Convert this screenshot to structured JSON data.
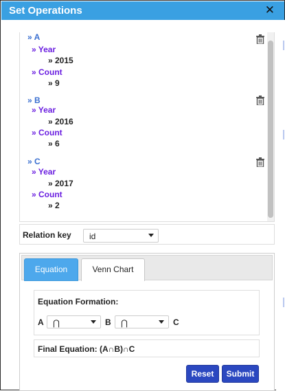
{
  "dialog": {
    "title": "Set Operations",
    "close_icon": "close-icon",
    "close_glyph": "✕"
  },
  "sets": [
    {
      "name": "» A",
      "entries": [
        {
          "key": "» Year",
          "value": "» 2015"
        },
        {
          "key": "» Count",
          "value": "» 9"
        }
      ]
    },
    {
      "name": "» B",
      "entries": [
        {
          "key": "» Year",
          "value": "» 2016"
        },
        {
          "key": "» Count",
          "value": "» 6"
        }
      ]
    },
    {
      "name": "» C",
      "entries": [
        {
          "key": "» Year",
          "value": "» 2017"
        },
        {
          "key": "» Count",
          "value": "» 2"
        }
      ]
    }
  ],
  "relation": {
    "label": "Relation key",
    "selected": "id"
  },
  "tabs": [
    {
      "label": "Equation",
      "active": true
    },
    {
      "label": "Venn Chart",
      "active": false
    }
  ],
  "equation": {
    "title": "Equation Formation:",
    "operand_a": "A",
    "operator_1": "⋂",
    "operand_b": "B",
    "operator_2": "⋂",
    "operand_c": "C"
  },
  "final_equation": "Final Equation: (A∩B)∩C",
  "buttons": {
    "reset": "Reset",
    "submit": "Submit"
  },
  "colors": {
    "title_bar": "#3aa0e2",
    "set_label": "#3a6fd0",
    "key_label": "#6a1ee0",
    "active_tab": "#4da8ec",
    "button": "#2b48c0"
  }
}
